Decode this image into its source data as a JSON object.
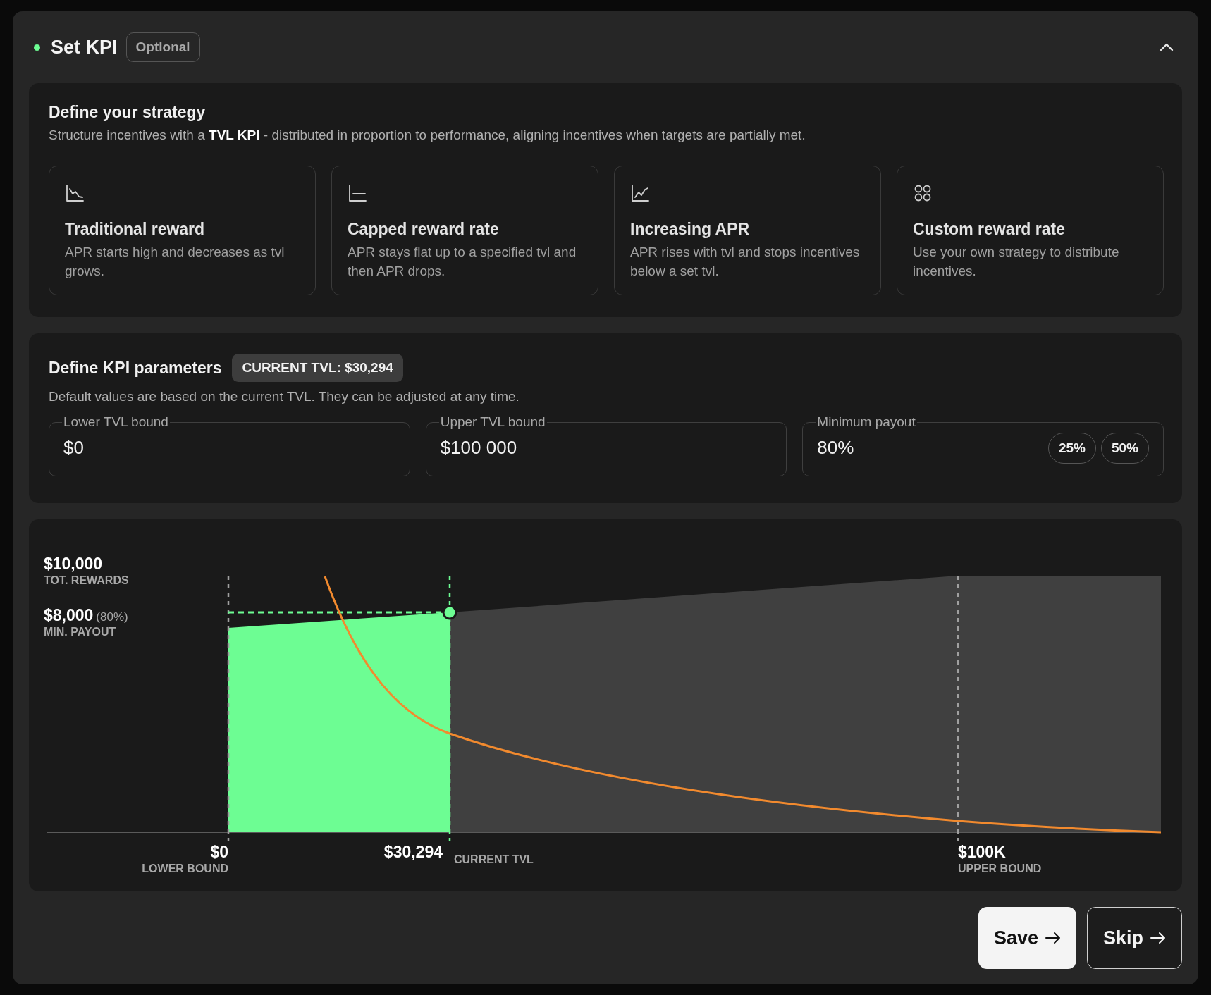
{
  "header": {
    "title": "Set KPI",
    "badge": "Optional",
    "expanded": true
  },
  "strategy": {
    "title": "Define your strategy",
    "description": "Structure incentives with a **TVL KPI** - distributed in proportion to performance, aligning incentives when targets are partially met.",
    "cards": [
      {
        "kind": "decreasing",
        "title": "Traditional reward",
        "description": "APR starts high and decreases as tvl grows."
      },
      {
        "kind": "capped",
        "title": "Capped reward rate",
        "description": "APR stays flat up to a specified tvl and then APR drops."
      },
      {
        "kind": "increasing",
        "title": "Increasing APR",
        "description": "APR rises with tvl and stops incentives below a set tvl."
      },
      {
        "kind": "custom",
        "title": "Custom reward rate",
        "description": "Use your own strategy to distribute incentives."
      }
    ]
  },
  "parameters": {
    "title": "Define KPI parameters",
    "badge": "CURRENT TVL: $30,294",
    "description": "Default values are based on the current TVL. They can be adjusted at any time.",
    "fields": [
      {
        "label": "Lower TVL bound",
        "value": "$0"
      },
      {
        "label": "Upper TVL bound",
        "value": "$100 000"
      },
      {
        "label": "Minimum payout",
        "value": "80%",
        "presets": [
          "25%",
          "50%"
        ]
      }
    ]
  },
  "chart": {
    "y_labels": [
      {
        "kind": "total",
        "value": "$10,000",
        "caption": "TOT. REWARDS"
      },
      {
        "kind": "minimum",
        "value": "$8,000",
        "note": "(80%)",
        "caption": "MIN. PAYOUT"
      }
    ],
    "x_labels": [
      {
        "kind": "lower",
        "value": "$0",
        "caption": "LOWER BOUND"
      },
      {
        "kind": "current",
        "value": "$30,294",
        "caption": "CURRENT TVL"
      },
      {
        "kind": "upper",
        "value": "$100K",
        "caption": "UPPER BOUND"
      }
    ]
  },
  "buttons": [
    {
      "kind": "primary",
      "label": "Save"
    },
    {
      "kind": "secondary",
      "label": "Skip"
    }
  ]
}
